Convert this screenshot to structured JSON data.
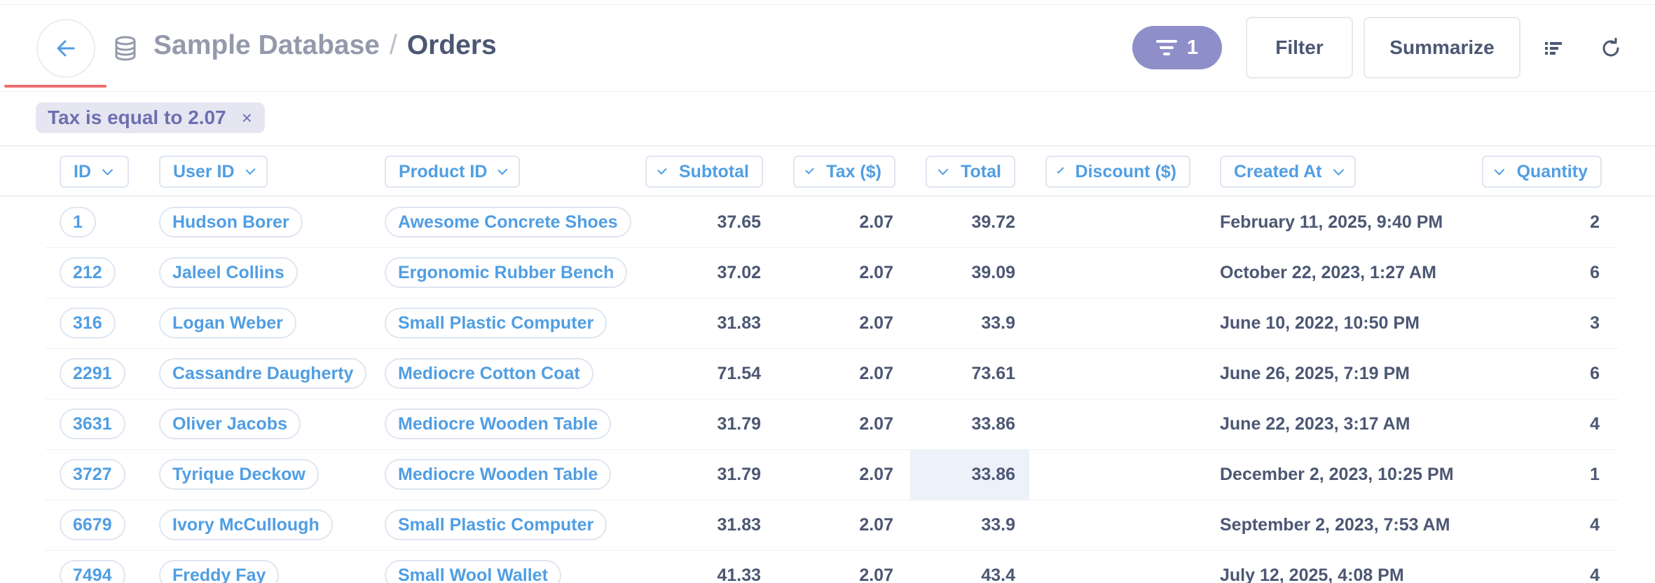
{
  "breadcrumb": {
    "database": "Sample Database",
    "separator": "/",
    "table": "Orders"
  },
  "toolbar": {
    "filter_count": "1",
    "filter_label": "Filter",
    "summarize_label": "Summarize"
  },
  "active_filter": {
    "label": "Tax is equal to 2.07",
    "remove": "×"
  },
  "icons": [
    "back-arrow-icon",
    "database-icon",
    "filter-funnel-icon",
    "list-icon",
    "refresh-icon",
    "chevron-down-icon",
    "close-icon"
  ],
  "colors": {
    "brand": "#509ee3",
    "filter_accent": "#8e8fc9",
    "loading_bar": "#ed6e6e",
    "text": "#4c5773",
    "muted": "#949aab"
  },
  "table": {
    "columns": [
      "ID",
      "User ID",
      "Product ID",
      "Subtotal",
      "Tax ($)",
      "Total",
      "Discount ($)",
      "Created At",
      "Quantity"
    ],
    "rows": [
      {
        "id": "1",
        "user": "Hudson Borer",
        "product": "Awesome Concrete Shoes",
        "subtotal": "37.65",
        "tax": "2.07",
        "total": "39.72",
        "discount": "",
        "created": "February 11, 2025, 9:40 PM",
        "quantity": "2"
      },
      {
        "id": "212",
        "user": "Jaleel Collins",
        "product": "Ergonomic Rubber Bench",
        "subtotal": "37.02",
        "tax": "2.07",
        "total": "39.09",
        "discount": "",
        "created": "October 22, 2023, 1:27 AM",
        "quantity": "6"
      },
      {
        "id": "316",
        "user": "Logan Weber",
        "product": "Small Plastic Computer",
        "subtotal": "31.83",
        "tax": "2.07",
        "total": "33.9",
        "discount": "",
        "created": "June 10, 2022, 10:50 PM",
        "quantity": "3"
      },
      {
        "id": "2291",
        "user": "Cassandre Daugherty",
        "product": "Mediocre Cotton Coat",
        "subtotal": "71.54",
        "tax": "2.07",
        "total": "73.61",
        "discount": "",
        "created": "June 26, 2025, 7:19 PM",
        "quantity": "6"
      },
      {
        "id": "3631",
        "user": "Oliver Jacobs",
        "product": "Mediocre Wooden Table",
        "subtotal": "31.79",
        "tax": "2.07",
        "total": "33.86",
        "discount": "",
        "created": "June 22, 2023, 3:17 AM",
        "quantity": "4"
      },
      {
        "id": "3727",
        "user": "Tyrique Deckow",
        "product": "Mediocre Wooden Table",
        "subtotal": "31.79",
        "tax": "2.07",
        "total": "33.86",
        "discount": "",
        "created": "December 2, 2023, 10:25 PM",
        "quantity": "1"
      },
      {
        "id": "6679",
        "user": "Ivory McCullough",
        "product": "Small Plastic Computer",
        "subtotal": "31.83",
        "tax": "2.07",
        "total": "33.9",
        "discount": "",
        "created": "September 2, 2023, 7:53 AM",
        "quantity": "4"
      },
      {
        "id": "7494",
        "user": "Freddy Fay",
        "product": "Small Wool Wallet",
        "subtotal": "41.33",
        "tax": "2.07",
        "total": "43.4",
        "discount": "",
        "created": "July 12, 2025, 4:08 PM",
        "quantity": "4"
      }
    ]
  }
}
